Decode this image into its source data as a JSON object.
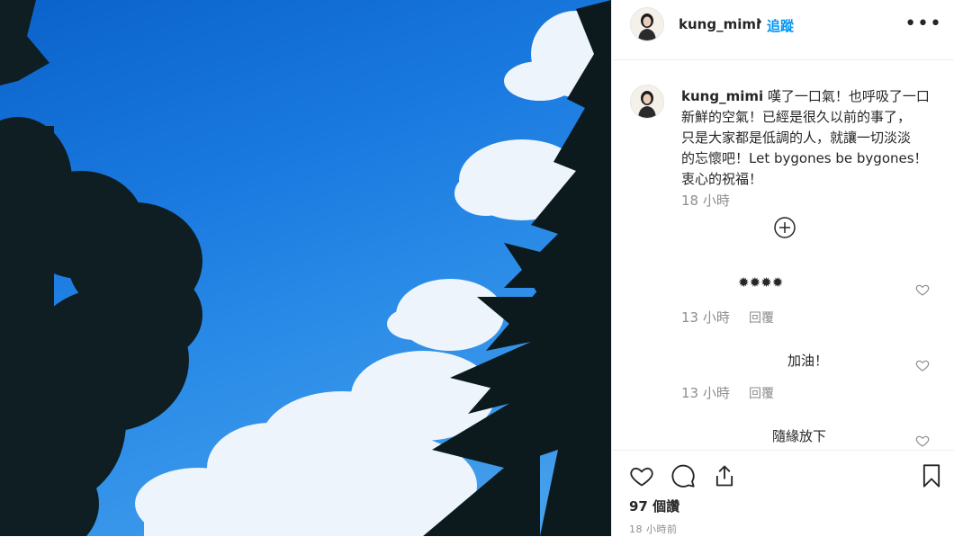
{
  "post": {
    "username": "kung_mimi",
    "follow_label": "追蹤",
    "separator": "•",
    "more_label": "•••"
  },
  "caption": {
    "username": "kung_mimi",
    "line1": "嘆了一口氣！也呼吸了一口",
    "line2": "新鮮的空氣！已經是很久以前的事了，",
    "line3": "只是大家都是低調的人，就讓一切淡淡",
    "line4": "的忘懷吧！Let bygones be bygones！",
    "line5": "衷心的祝福！",
    "time": "18 小時"
  },
  "comments": [
    {
      "text": "✹✹✹✹",
      "time": "13 小時",
      "reply_label": "回覆"
    },
    {
      "text": "加油！",
      "time": "13 小時",
      "reply_label": "回覆"
    },
    {
      "text": "隨緣放下"
    }
  ],
  "footer": {
    "likes": "97 個讚",
    "timestamp": "18 小時前"
  },
  "colors": {
    "accent": "#0095f6",
    "sky": "#1a7ae0",
    "muted": "#8e8e8e"
  },
  "icons": [
    "more-icon",
    "load-more-icon",
    "like-icon",
    "comment-icon",
    "share-icon",
    "save-icon"
  ]
}
